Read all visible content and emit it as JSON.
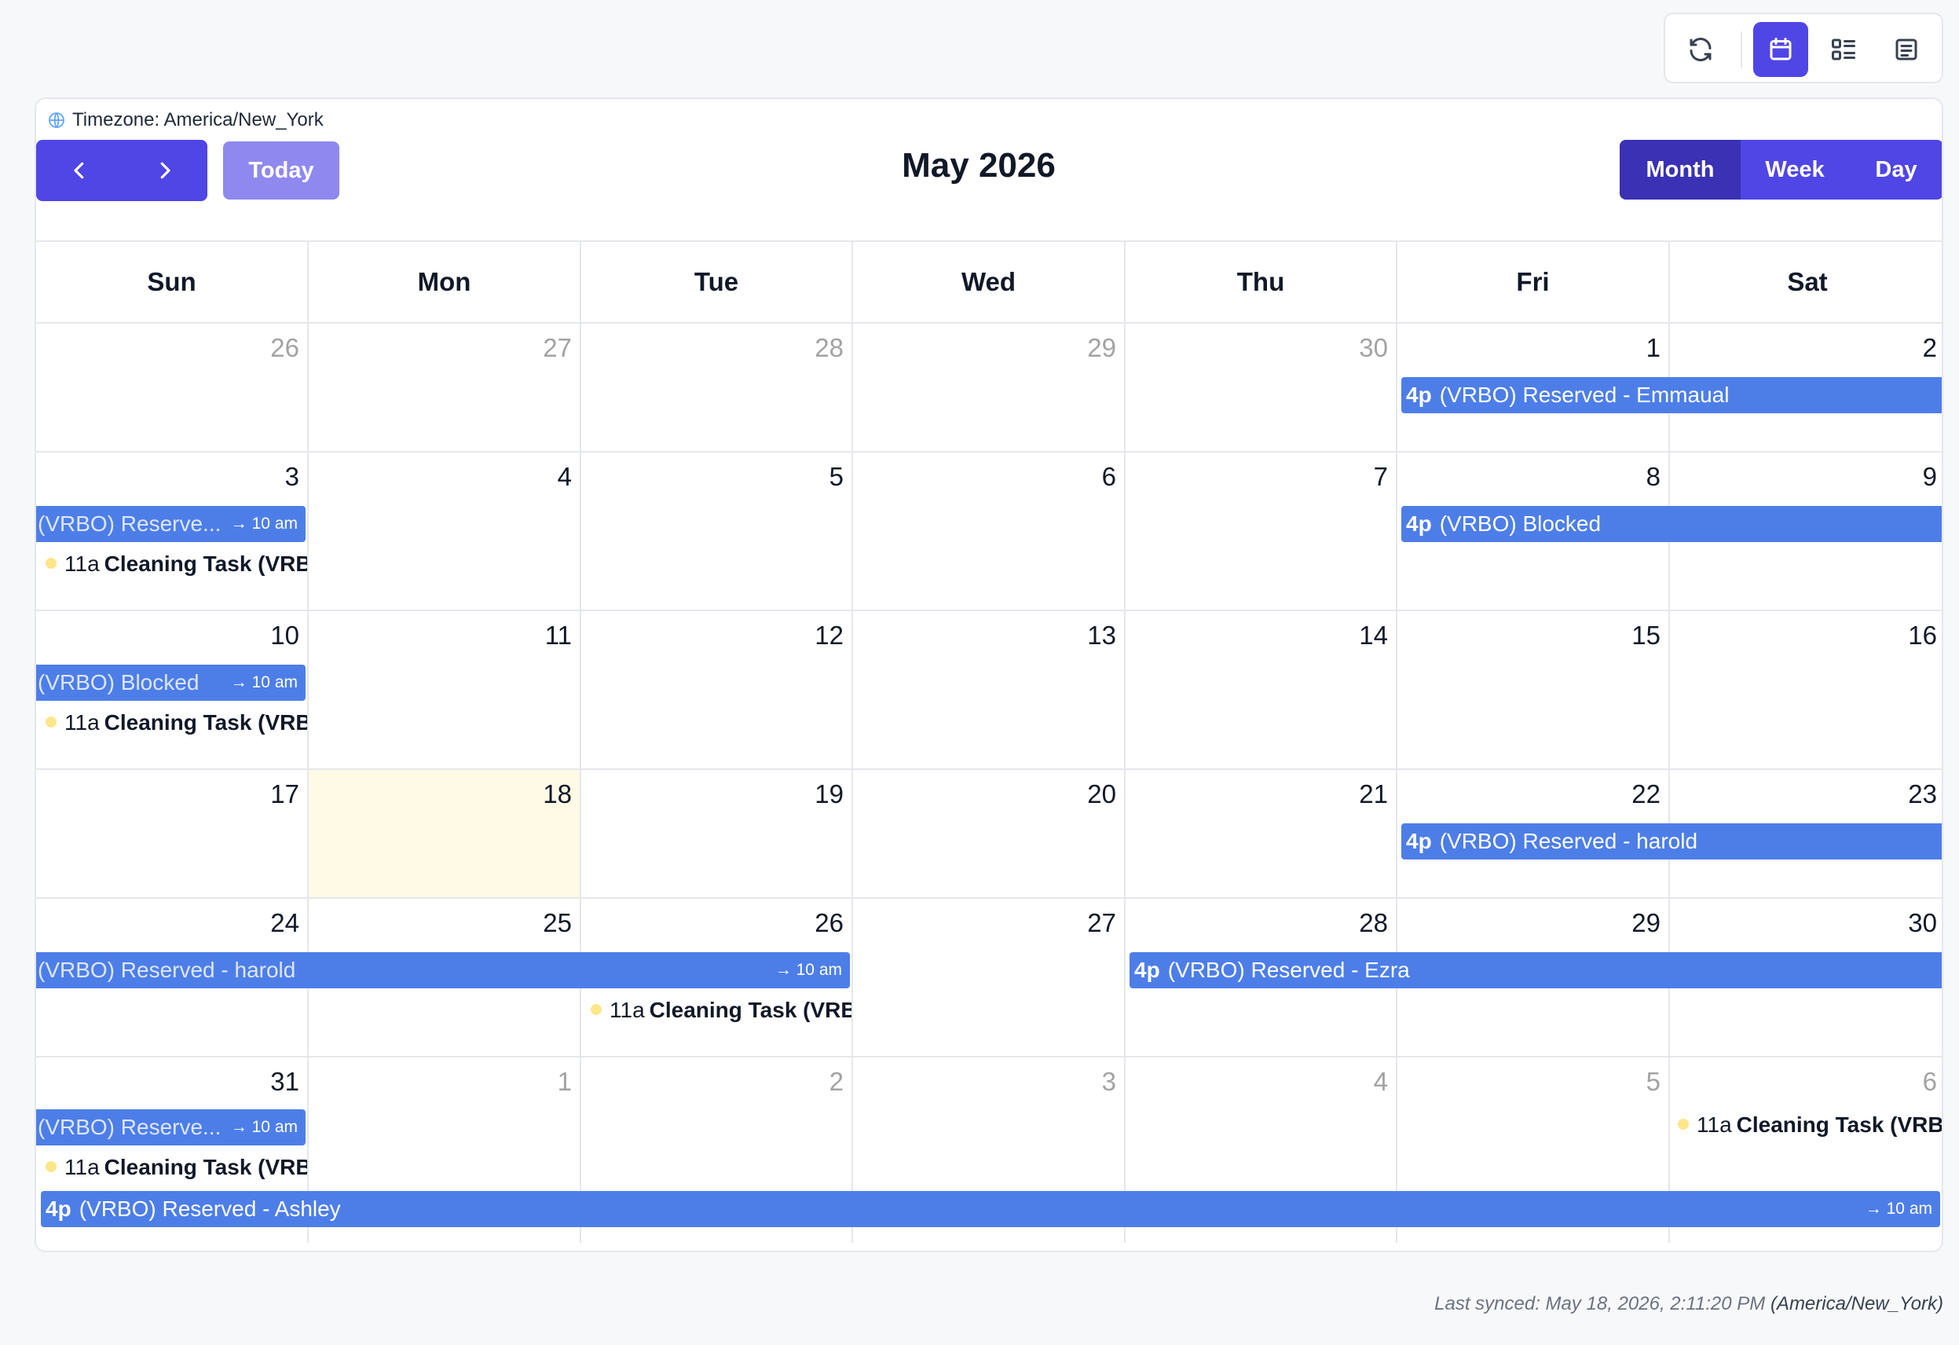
{
  "toolbar": {
    "buttons": [
      {
        "name": "refresh-button",
        "icon": "refresh-icon",
        "active": false
      },
      {
        "name": "calendar-view-button",
        "icon": "calendar-icon",
        "active": true
      },
      {
        "name": "list-view-button",
        "icon": "list-icon",
        "active": false
      },
      {
        "name": "document-view-button",
        "icon": "document-icon",
        "active": false
      }
    ],
    "accent": "#5046e5"
  },
  "timezone": {
    "label": "Timezone: America/New_York",
    "icon": "globe-icon"
  },
  "nav": {
    "prev_icon": "chevron-left-icon",
    "next_icon": "chevron-right-icon",
    "today_label": "Today"
  },
  "title": "May 2026",
  "views": [
    {
      "label": "Month",
      "active": true
    },
    {
      "label": "Week",
      "active": false
    },
    {
      "label": "Day",
      "active": false
    }
  ],
  "weekdays": [
    "Sun",
    "Mon",
    "Tue",
    "Wed",
    "Thu",
    "Fri",
    "Sat"
  ],
  "weeks": [
    {
      "days": [
        {
          "num": "26",
          "other": true
        },
        {
          "num": "27",
          "other": true
        },
        {
          "num": "28",
          "other": true
        },
        {
          "num": "29",
          "other": true
        },
        {
          "num": "30",
          "other": true
        },
        {
          "num": "1"
        },
        {
          "num": "2"
        }
      ]
    },
    {
      "days": [
        {
          "num": "3"
        },
        {
          "num": "4"
        },
        {
          "num": "5"
        },
        {
          "num": "6"
        },
        {
          "num": "7"
        },
        {
          "num": "8"
        },
        {
          "num": "9"
        }
      ]
    },
    {
      "days": [
        {
          "num": "10"
        },
        {
          "num": "11"
        },
        {
          "num": "12"
        },
        {
          "num": "13"
        },
        {
          "num": "14"
        },
        {
          "num": "15"
        },
        {
          "num": "16"
        }
      ]
    },
    {
      "days": [
        {
          "num": "17"
        },
        {
          "num": "18",
          "today": true
        },
        {
          "num": "19"
        },
        {
          "num": "20"
        },
        {
          "num": "21"
        },
        {
          "num": "22"
        },
        {
          "num": "23"
        }
      ]
    },
    {
      "days": [
        {
          "num": "24"
        },
        {
          "num": "25"
        },
        {
          "num": "26"
        },
        {
          "num": "27"
        },
        {
          "num": "28"
        },
        {
          "num": "29"
        },
        {
          "num": "30"
        }
      ]
    },
    {
      "days": [
        {
          "num": "31"
        },
        {
          "num": "1",
          "other": true
        },
        {
          "num": "2",
          "other": true
        },
        {
          "num": "3",
          "other": true
        },
        {
          "num": "4",
          "other": true
        },
        {
          "num": "5",
          "other": true
        },
        {
          "num": "6",
          "other": true
        }
      ]
    }
  ],
  "events": {
    "w1_emmaual": {
      "time": "4p",
      "title": "(VRBO) Reserved - Emmaual"
    },
    "w2_reserved_cont": {
      "title": "(VRBO) Reserve...",
      "end": "→ 10 am"
    },
    "w2_blocked": {
      "time": "4p",
      "title": "(VRBO) Blocked"
    },
    "w3_blocked_cont": {
      "title": "(VRBO) Blocked",
      "end": "→ 10 am"
    },
    "w4_harold": {
      "time": "4p",
      "title": "(VRBO) Reserved - harold"
    },
    "w5_harold_cont": {
      "title": "(VRBO) Reserved - harold",
      "end": "→ 10 am"
    },
    "w5_ezra": {
      "time": "4p",
      "title": "(VRBO) Reserved - Ezra"
    },
    "w6_ezra_cont": {
      "title": "(VRBO) Reserve...",
      "end": "→ 10 am"
    },
    "w6_ashley": {
      "time": "4p",
      "title": "(VRBO) Reserved - Ashley",
      "end": "→ 10 am"
    }
  },
  "tasks": {
    "t1": {
      "time": "11a",
      "title": "Cleaning Task (VRBO)"
    },
    "t2": {
      "time": "11a",
      "title": "Cleaning Task (VRBO)"
    },
    "t3": {
      "time": "11a",
      "title": "Cleaning Task (VRBO)"
    },
    "t4": {
      "time": "11a",
      "title": "Cleaning Task (VRBO)"
    },
    "t5": {
      "time": "11a",
      "title": "Cleaning Task (VRBO)"
    }
  },
  "colors": {
    "event": "#4d7ee8",
    "task_dot": "#fde68a",
    "today_bg": "#fefae6"
  },
  "footer": {
    "synced": "Last synced: May 18, 2026, 2:11:20 PM",
    "synced_tz": "(America/New_York)"
  }
}
